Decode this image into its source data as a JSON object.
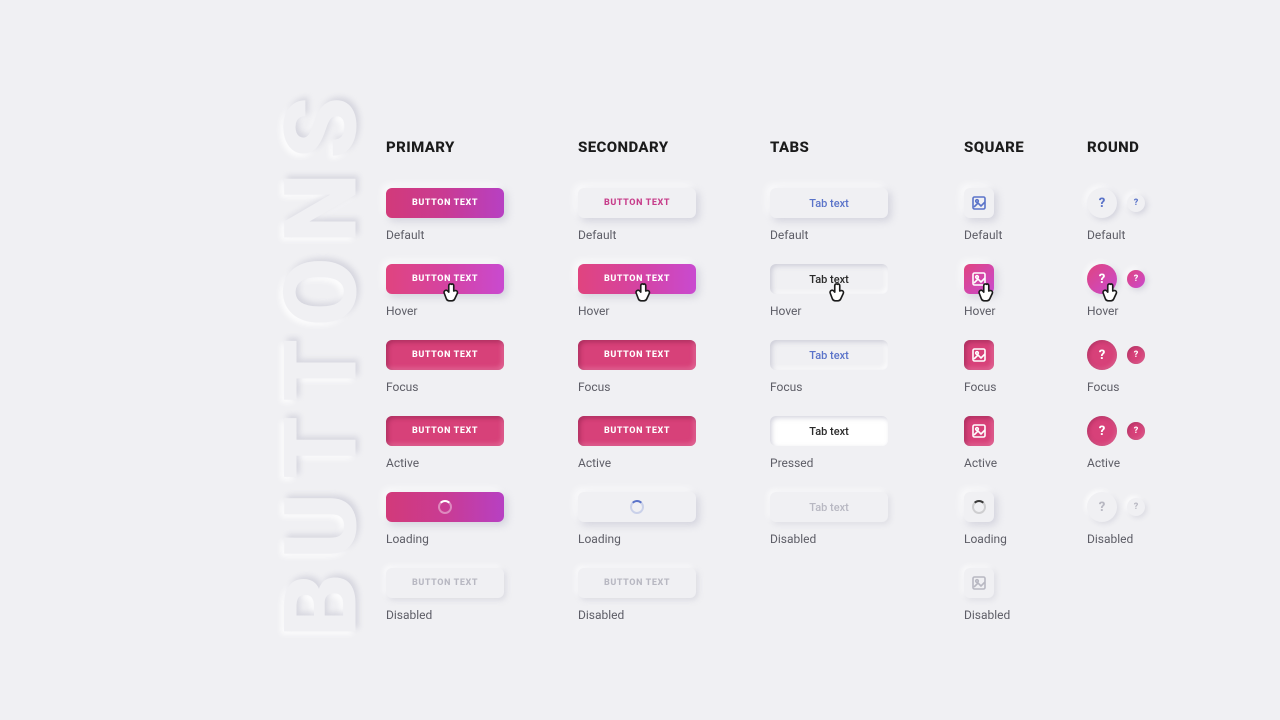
{
  "side_title": "BUTTONS",
  "columns": {
    "primary": {
      "heading": "PRIMARY"
    },
    "secondary": {
      "heading": "SECONDARY"
    },
    "tabs": {
      "heading": "TABS"
    },
    "square": {
      "heading": "SQUARE"
    },
    "round": {
      "heading": "ROUND"
    }
  },
  "button_label": "BUTTON TEXT",
  "tab_label": "Tab text",
  "round_glyph": "?",
  "states": {
    "default": "Default",
    "hover": "Hover",
    "focus": "Focus",
    "active": "Active",
    "pressed": "Pressed",
    "loading": "Loading",
    "disabled": "Disabled"
  },
  "colors": {
    "gradient_start": "#d23a7a",
    "gradient_end": "#b740c3",
    "solid_pink": "#d74179",
    "link_blue": "#5a73c9",
    "disabled_text": "#b8b8c2",
    "bg": "#f0f0f3"
  }
}
